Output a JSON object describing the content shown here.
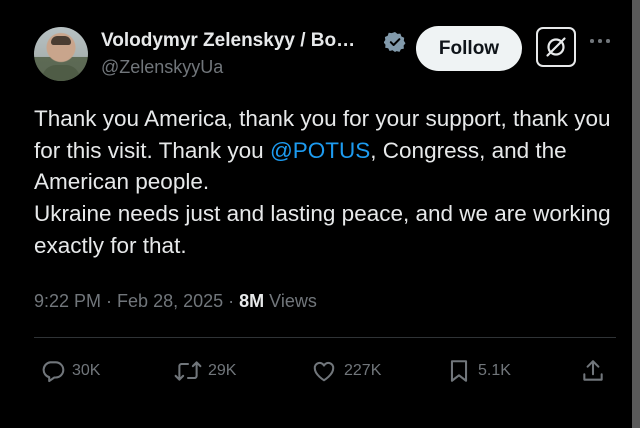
{
  "author": {
    "name": "Volodymyr Zelenskyy / Bo…",
    "handle": "@ZelenskyyUa",
    "verified": true
  },
  "follow_label": "Follow",
  "tweet": {
    "line1_part1": "Thank you America, thank you for your support, thank you for this visit. Thank you ",
    "mention": "@POTUS",
    "line1_part2": ", Congress, and the American people.",
    "line2": "Ukraine needs just and lasting peace, and we are working exactly for that."
  },
  "meta": {
    "time": "9:22 PM",
    "sep1": " · ",
    "date": "Feb 28, 2025",
    "sep2": " · ",
    "views_count": "8M",
    "views_label": " Views"
  },
  "actions": {
    "replies": "30K",
    "reposts": "29K",
    "likes": "227K",
    "bookmarks": "5.1K"
  },
  "colors": {
    "background": "#000000",
    "text": "#e7e9ea",
    "muted": "#71767b",
    "link": "#1d9bf0",
    "follow_bg": "#eff3f4"
  },
  "icons": [
    "verified-badge-icon",
    "grok-icon",
    "more-icon",
    "reply-icon",
    "repost-icon",
    "like-icon",
    "bookmark-icon",
    "share-icon"
  ]
}
